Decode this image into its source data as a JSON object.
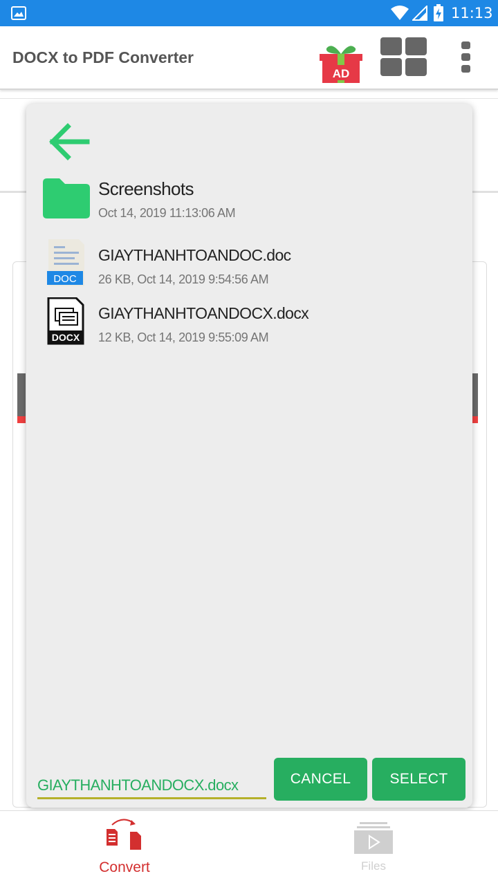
{
  "status_bar": {
    "time": "11:13"
  },
  "app_bar": {
    "title": "DOCX to PDF Converter",
    "ad_badge": "AD"
  },
  "file_picker": {
    "entries": [
      {
        "name": "Screenshots",
        "meta": "Oct 14, 2019 11:13:06 AM",
        "type": "folder"
      },
      {
        "name": "GIAYTHANHTOANDOC.doc",
        "meta": "26 KB, Oct 14, 2019 9:54:56 AM",
        "type": "doc",
        "badge": "DOC"
      },
      {
        "name": "GIAYTHANHTOANDOCX.docx",
        "meta": "12 KB, Oct 14, 2019 9:55:09 AM",
        "type": "docx",
        "badge": "DOCX"
      }
    ],
    "filename_value": "GIAYTHANHTOANDOCX.docx",
    "cancel_label": "CANCEL",
    "select_label": "SELECT"
  },
  "bottom_nav": {
    "convert_label": "Convert",
    "files_label": "Files"
  },
  "colors": {
    "status_bar": "#1e88e5",
    "accent_green": "#27ae60",
    "folder_green": "#2ecc71",
    "active_red": "#d32f2f",
    "inactive_gray": "#cfcfcf"
  }
}
